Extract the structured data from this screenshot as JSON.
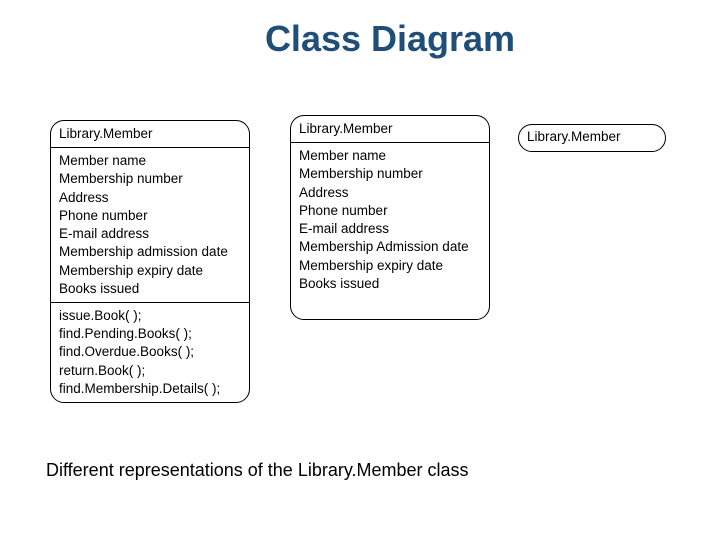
{
  "title": "Class Diagram",
  "caption": "Different representations of the Library.Member class",
  "classA": {
    "name": "Library.Member",
    "attributes": [
      "Member name",
      "Membership number",
      "Address",
      "Phone number",
      "E-mail address",
      "Membership admission date",
      "Membership expiry date",
      "Books issued"
    ],
    "operations": [
      "issue.Book( );",
      "find.Pending.Books( );",
      "find.Overdue.Books( );",
      "return.Book( );",
      "find.Membership.Details( );"
    ]
  },
  "classB": {
    "name": "Library.Member",
    "attributes": [
      "Member name",
      "Membership number",
      "Address",
      "Phone number",
      "E-mail address",
      "Membership Admission date",
      "Membership expiry date",
      "Books issued"
    ]
  },
  "classC": {
    "name": "Library.Member"
  }
}
